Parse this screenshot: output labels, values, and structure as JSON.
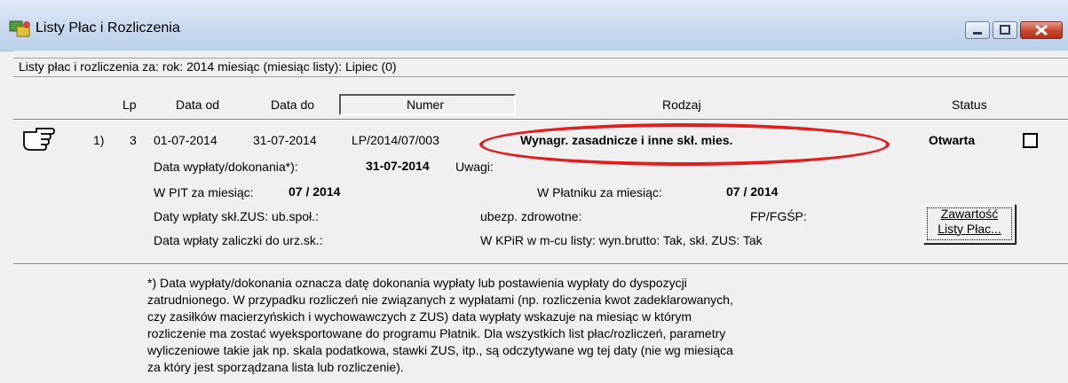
{
  "window": {
    "title": "Listy Płac i Rozliczenia"
  },
  "info_bar": {
    "text": "Listy płac i rozliczenia za:  rok:  2014   miesiąc (miesiąc listy): Lipiec (0)"
  },
  "columns": {
    "lp": "Lp",
    "date_from": "Data od",
    "date_to": "Data do",
    "number": "Numer",
    "type": "Rodzaj",
    "status": "Status"
  },
  "row": {
    "index": "1)",
    "lp": "3",
    "date_from": "01-07-2014",
    "date_to": "31-07-2014",
    "number": "LP/2014/07/003",
    "type": "Wynagr. zasadnicze i inne skł. mies.",
    "status": "Otwarta",
    "payment_date_label": "Data wypłaty/dokonania*):",
    "payment_date": "31-07-2014",
    "notes_label": "Uwagi:",
    "pit_label": "W PIT za miesiąc:",
    "pit_value": "07 / 2014",
    "platnik_label": "W Płatniku za miesiąc:",
    "platnik_value": "07 / 2014",
    "zus_dates_label": "Daty wpłaty skł.ZUS: ub.społ.:",
    "health_label": "ubezp. zdrowotne:",
    "fp_label": "FP/FGŚP:",
    "tax_advance_label": "Data wpłaty zaliczki do urz.sk.:",
    "kpir_text": "W KPiR w m-cu listy:  wyn.brutto: Tak, skł. ZUS: Tak"
  },
  "button": {
    "line1": "Zawartość",
    "line2": "Listy Płac..."
  },
  "footnote": [
    "*) Data wypłaty/dokonania oznacza datę dokonania wypłaty lub postawienia wypłaty do dyspozycji",
    "zatrudnionego. W przypadku rozliczeń nie związanych z wypłatami (np. rozliczenia kwot zadeklarowanych,",
    "czy zasiłków macierzyńskich i wychowawczych z ZUS) data wypłaty wskazuje na miesiąc w którym",
    "rozliczenie ma zostać wyeksportowane do programu Płatnik. Dla wszystkich list płac/rozliczeń, parametry",
    "wyliczeniowe takie jak np. skala podatkowa, stawki ZUS, itp., są odczytywane wg tej daty (nie wg miesiąca",
    "za który jest sporządzana lista lub rozliczenie)."
  ],
  "colors": {
    "highlight_ellipse": "#e0201f",
    "close_button": "#c9452f"
  },
  "icons": {
    "window": "app-icon",
    "pointer": "pointing-hand-icon"
  }
}
